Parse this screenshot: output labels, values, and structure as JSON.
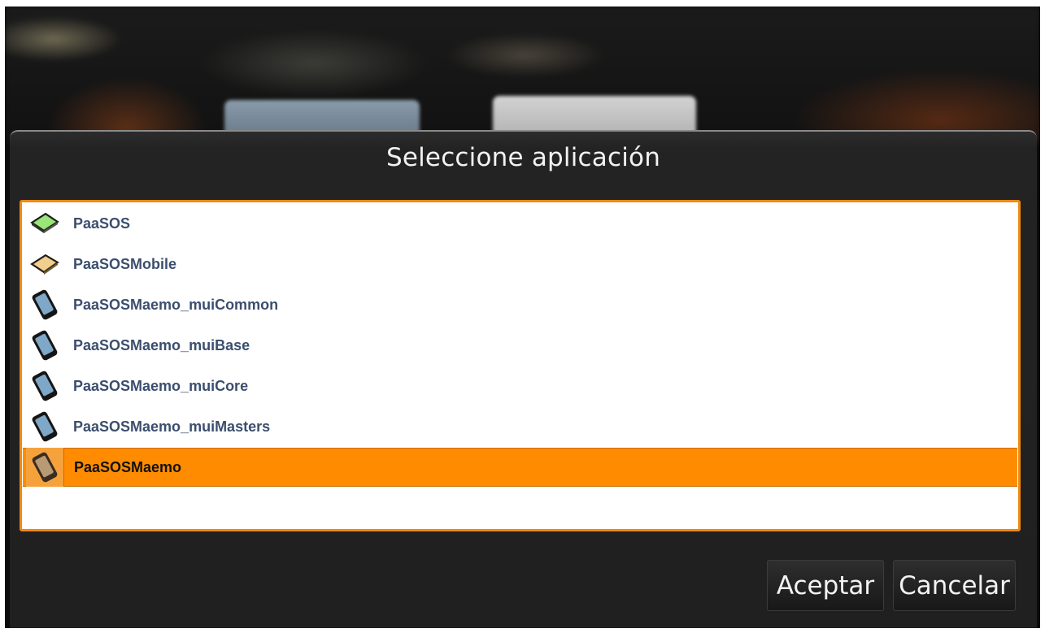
{
  "dialog": {
    "title": "Seleccione aplicación",
    "items": [
      {
        "label": "PaaSOS",
        "icon": "desktop-monitor-green-icon",
        "selected": false
      },
      {
        "label": "PaaSOSMobile",
        "icon": "tablet-device-tan-icon",
        "selected": false
      },
      {
        "label": "PaaSOSMaemo_muiCommon",
        "icon": "mobile-phone-icon",
        "selected": false
      },
      {
        "label": "PaaSOSMaemo_muiBase",
        "icon": "mobile-phone-icon",
        "selected": false
      },
      {
        "label": "PaaSOSMaemo_muiCore",
        "icon": "mobile-phone-icon",
        "selected": false
      },
      {
        "label": "PaaSOSMaemo_muiMasters",
        "icon": "mobile-phone-icon",
        "selected": false
      },
      {
        "label": "PaaSOSMaemo",
        "icon": "mobile-phone-brown-icon",
        "selected": true
      }
    ],
    "accept_label": "Aceptar",
    "cancel_label": "Cancelar"
  },
  "colors": {
    "accent": "#ff8c00",
    "item_text": "#3b4e6e",
    "dialog_bg": "#202020"
  }
}
